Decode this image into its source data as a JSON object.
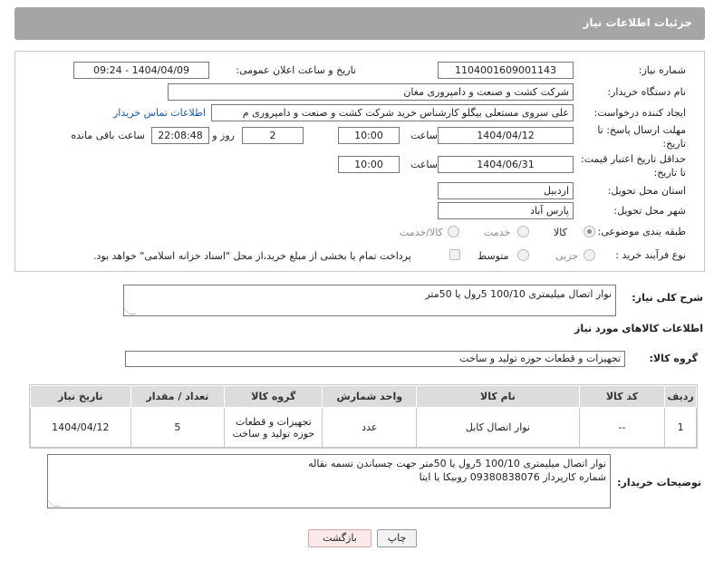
{
  "header": {
    "title": "جزئیات اطلاعات نیاز"
  },
  "form": {
    "need_number_label": "شماره نیاز:",
    "need_number": "1104001609001143",
    "announce_label": "تاریخ و ساعت اعلان عمومی:",
    "announce_value": "1404/04/09 - 09:24",
    "buyer_org_label": "نام دستگاه خریدار:",
    "buyer_org": "شرکت کشت و صنعت و دامپروری مغان",
    "creator_label": "ایجاد کننده درخواست:",
    "creator": "علی سروی مستعلی بیگلو کارشناس خرید شرکت کشت و صنعت و دامپروری م",
    "contact_link": "اطلاعات تماس خریدار",
    "deadline_label_1": "مهلت ارسال پاسخ: تا",
    "deadline_label_2": "تاریخ:",
    "deadline_date": "1404/04/12",
    "time_label": "ساعت",
    "deadline_time": "10:00",
    "days_value": "2",
    "days_label": "روز و",
    "remaining_time": "22:08:48",
    "remaining_label": "ساعت باقی مانده",
    "validity_label_1": "حداقل تاریخ اعتبار قیمت:",
    "validity_label_2": "تا تاریخ:",
    "validity_date": "1404/06/31",
    "validity_time": "10:00",
    "province_label": "استان محل تحویل:",
    "province": "اردبیل",
    "city_label": "شهر محل تحویل:",
    "city": "پارس آباد",
    "category_label": "طبقه بندی موضوعی:",
    "category_options": [
      "کالا",
      "خدمت",
      "کالا/خدمت"
    ],
    "category_selected": "کالا",
    "process_label": "نوع فرآیند خرید :",
    "process_options": [
      "جزیی",
      "متوسط"
    ],
    "payment_note": "پرداخت تمام یا بخشی از مبلغ خرید،از محل \"اسناد خزانه اسلامی\" خواهد بود."
  },
  "summary": {
    "label": "شرح کلی نیاز:",
    "text": "نوار اتصال میلیمتری 100/10     5رول یا 50متر"
  },
  "goods": {
    "section_title": "اطلاعات کالاهای مورد نیاز",
    "group_label": "گروه کالا:",
    "group_value": "تجهیزات و قطعات حوزه تولید و ساخت",
    "columns": [
      "ردیف",
      "کد کالا",
      "نام کالا",
      "واحد شمارش",
      "گروه کالا",
      "تعداد / مقدار",
      "تاریخ نیاز"
    ],
    "rows": [
      [
        "1",
        "--",
        "نوار اتصال کابل",
        "عدد",
        "تجهیزات و قطعات حوزه تولید و ساخت",
        "5",
        "1404/04/12"
      ]
    ]
  },
  "buyer_notes": {
    "label": "توضیحات خریدار:",
    "line1": "نوار اتصال میلیمتری 100/10     5رول یا 50متر جهت چسباندن تسمه نقاله",
    "line2": "شماره کارپرداز 09380838076 روبیکا یا ایتا"
  },
  "buttons": {
    "print": "چاپ",
    "back": "بازگشت"
  },
  "colors": {
    "title_bar": "#a5a5a5",
    "link": "#1a57b3",
    "back_button": "#fbe9e9"
  }
}
